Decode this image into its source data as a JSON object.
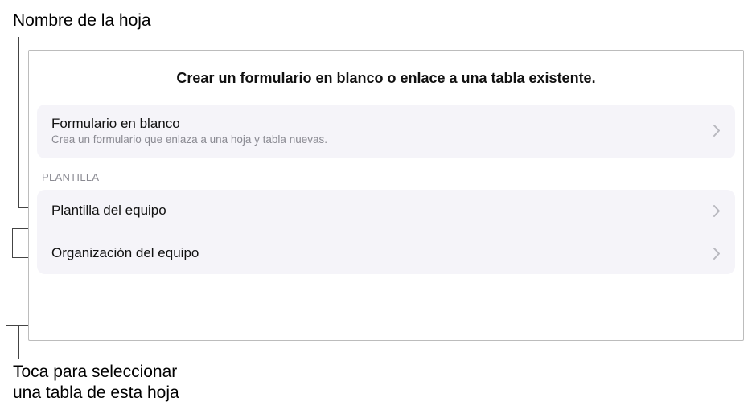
{
  "callouts": {
    "top": "Nombre de la hoja",
    "bottom": "Toca para seleccionar\nuna tabla de esta hoja"
  },
  "panel": {
    "title": "Crear un formulario en blanco o enlace a una tabla existente.",
    "blankForm": {
      "title": "Formulario en blanco",
      "subtitle": "Crea un formulario que enlaza a una hoja y tabla nuevas."
    },
    "sectionLabel": "PLANTILLA",
    "tables": [
      {
        "label": "Plantilla del equipo"
      },
      {
        "label": "Organización del equipo"
      }
    ]
  }
}
